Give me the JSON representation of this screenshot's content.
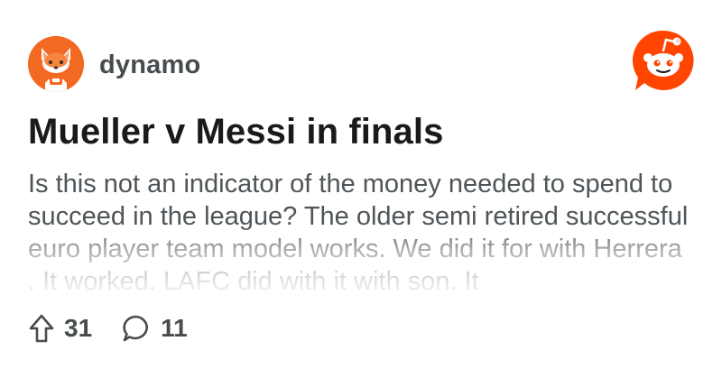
{
  "post": {
    "author": "dynamo",
    "title": "Mueller v Messi in finals",
    "body": "Is this not an indicator of the money needed to spend to succeed in the league? The older semi retired successful euro player team model works. We did it for with Herrera . It worked. LAFC did with it with son. It",
    "upvotes": "31",
    "comments": "11"
  },
  "icons": {
    "avatar": "fox-avatar-icon",
    "logo": "reddit-logo-icon",
    "upvote": "upvote-arrow-icon",
    "comment": "comment-bubble-icon"
  },
  "colors": {
    "brand": "#ff4500",
    "avatar_bg": "#f26a21",
    "meta_text": "#474c4f"
  }
}
